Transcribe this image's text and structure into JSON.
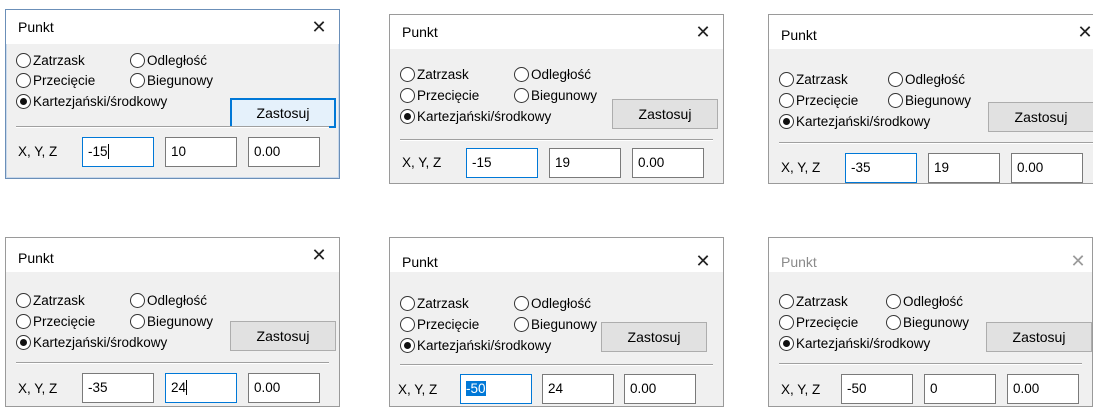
{
  "dialog": {
    "title": "Punkt",
    "close_glyph": "✕",
    "radio_snap": "Zatrzask",
    "radio_distance": "Odległość",
    "radio_intersection": "Przecięcie",
    "radio_polar": "Biegunowy",
    "radio_cartesian": "Kartezjański/środkowy",
    "apply_label": "Zastosuj",
    "xyz_label": "X, Y, Z",
    "selected_mode": "Kartezjański/środkowy"
  },
  "dialogs": [
    {
      "x": "-15",
      "y": "10",
      "z": "0.00",
      "state": "active, X field editing"
    },
    {
      "x": "-15",
      "y": "19",
      "z": "0.00",
      "state": "active, X field editing"
    },
    {
      "x": "-35",
      "y": "19",
      "z": "0.00",
      "state": "active, X field editing"
    },
    {
      "x": "-35",
      "y": "24",
      "z": "0.00",
      "state": "active, Y field editing"
    },
    {
      "x": "-50",
      "y": "24",
      "z": "0.00",
      "state": "active, X text selected"
    },
    {
      "x": "-50",
      "y": "0",
      "z": "0.00",
      "state": "inactive"
    }
  ],
  "icons": {
    "close": "close-icon",
    "radio_on": "radio-selected-icon",
    "radio_off": "radio-empty-icon"
  },
  "colors": {
    "focus_blue": "#0078d7",
    "dialog_bg": "#f0f0f0"
  }
}
